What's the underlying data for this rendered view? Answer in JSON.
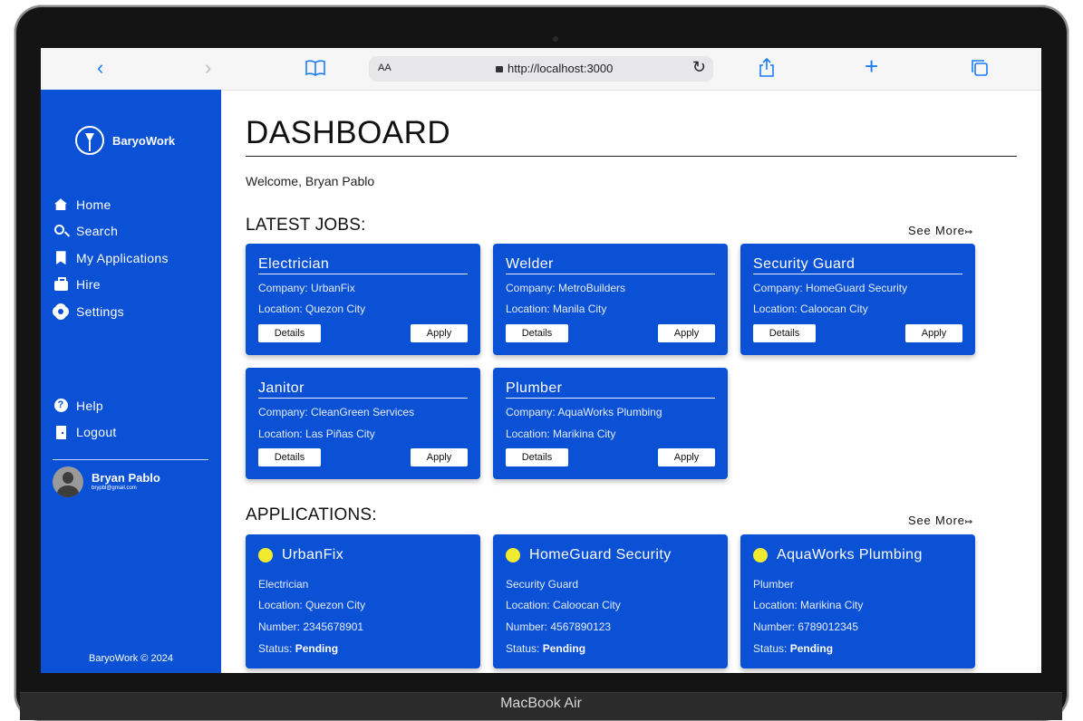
{
  "device": {
    "model_label": "MacBook Air"
  },
  "browser": {
    "url": "http://localhost:3000",
    "text_size_label": "AA",
    "icons": [
      "back-icon",
      "forward-icon",
      "bookmarks-icon",
      "lock-icon",
      "reload-icon",
      "share-icon",
      "new-tab-icon",
      "tabs-icon"
    ]
  },
  "sidebar": {
    "brand": "BaryoWork",
    "nav": [
      {
        "label": "Home",
        "icon": "home-icon"
      },
      {
        "label": "Search",
        "icon": "search-icon"
      },
      {
        "label": "My Applications",
        "icon": "bookmark-icon"
      },
      {
        "label": "Hire",
        "icon": "briefcase-icon"
      },
      {
        "label": "Settings",
        "icon": "gear-icon"
      }
    ],
    "bottom_nav": [
      {
        "label": "Help",
        "icon": "help-icon"
      },
      {
        "label": "Logout",
        "icon": "logout-icon"
      }
    ],
    "user": {
      "name": "Bryan Pablo",
      "email": "brypbl@gmail.com"
    },
    "copyright": "BaryoWork © 2024"
  },
  "main": {
    "title": "DASHBOARD",
    "welcome": "Welcome, Bryan Pablo",
    "latest_jobs": {
      "title": "LATEST JOBS:",
      "see_more": "See More",
      "details_label": "Details",
      "apply_label": "Apply",
      "jobs": [
        {
          "title": "Electrician",
          "company": "Company: UrbanFix",
          "location": "Location: Quezon City"
        },
        {
          "title": "Welder",
          "company": "Company: MetroBuilders",
          "location": "Location: Manila City"
        },
        {
          "title": "Security Guard",
          "company": "Company: HomeGuard Security",
          "location": "Location: Caloocan City"
        },
        {
          "title": "Janitor",
          "company": "Company: CleanGreen Services",
          "location": "Location: Las Piñas City"
        },
        {
          "title": "Plumber",
          "company": "Company: AquaWorks Plumbing",
          "location": "Location: Marikina City"
        }
      ]
    },
    "applications": {
      "title": "APPLICATIONS:",
      "see_more": "See More",
      "status_prefix": "Status:",
      "items": [
        {
          "company": "UrbanFix",
          "role": "Electrician",
          "location": "Location: Quezon City",
          "number": "Number: 2345678901",
          "status": "Pending"
        },
        {
          "company": "HomeGuard Security",
          "role": "Security Guard",
          "location": "Location: Caloocan City",
          "number": "Number: 4567890123",
          "status": "Pending"
        },
        {
          "company": "AquaWorks Plumbing",
          "role": "Plumber",
          "location": "Location: Marikina City",
          "number": "Number: 6789012345",
          "status": "Pending"
        }
      ]
    }
  },
  "colors": {
    "primary": "#0a51d6",
    "status_dot": "#f0eb2e",
    "browser_accent": "#1a7cf5"
  }
}
